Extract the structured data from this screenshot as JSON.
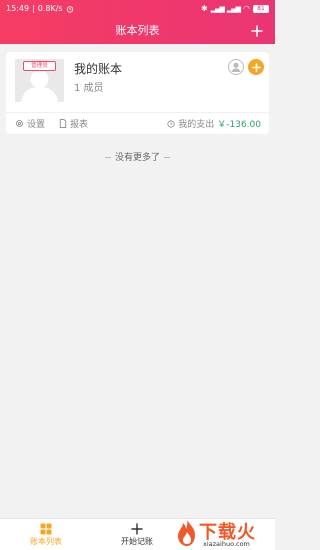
{
  "status_bar": {
    "time": "15:49",
    "net_speed": "0.8K/s",
    "battery": "81"
  },
  "header": {
    "title": "账本列表",
    "add_icon": "plus-icon"
  },
  "account_books": [
    {
      "name": "我的账本",
      "members": "1 成员",
      "badge": "管理员",
      "settings_label": "设置",
      "report_label": "报表",
      "expense_label": "我的支出",
      "expense_amount": "￥-136.00"
    }
  ],
  "list_end_text": "没有更多了",
  "tabbar": {
    "items": [
      {
        "label": "账本列表",
        "icon": "grid-icon",
        "active": true
      },
      {
        "label": "开始记账",
        "icon": "plus-icon",
        "active": false
      }
    ]
  },
  "watermark": {
    "text": "下载火",
    "url": "xiazaihuo.com"
  },
  "colors": {
    "header_gradient_start": "#f53d63",
    "header_gradient_end": "#ea3573",
    "accent_orange": "#f5a623",
    "expense_green": "#2aa56c",
    "badge_red": "#f5486e"
  }
}
